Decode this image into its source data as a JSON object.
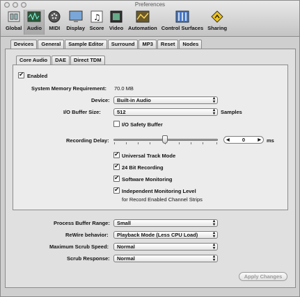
{
  "window": {
    "title": "Preferences"
  },
  "toolbar": {
    "items": [
      {
        "label": "Global",
        "icon": "global-icon"
      },
      {
        "label": "Audio",
        "icon": "audio-icon"
      },
      {
        "label": "MIDI",
        "icon": "midi-icon"
      },
      {
        "label": "Display",
        "icon": "display-icon"
      },
      {
        "label": "Score",
        "icon": "score-icon"
      },
      {
        "label": "Video",
        "icon": "video-icon"
      },
      {
        "label": "Automation",
        "icon": "automation-icon"
      },
      {
        "label": "Control Surfaces",
        "icon": "control-surfaces-icon"
      },
      {
        "label": "Sharing",
        "icon": "sharing-icon"
      }
    ],
    "active": "Audio"
  },
  "tabs": [
    "Devices",
    "General",
    "Sample Editor",
    "Surround",
    "MP3",
    "Reset",
    "Nodes"
  ],
  "subtabs": [
    "Core Audio",
    "DAE",
    "Direct TDM"
  ],
  "core_audio": {
    "enabled_label": "Enabled",
    "memory_label": "System Memory Requirement:",
    "memory_value": "70.0 MB",
    "device_label": "Device:",
    "device_value": "Built-in Audio",
    "buffer_label": "I/O Buffer Size:",
    "buffer_value": "512",
    "buffer_unit": "Samples",
    "safety_label": "I/O Safety Buffer",
    "delay_label": "Recording Delay:",
    "delay_value": "0",
    "delay_unit": "ms",
    "universal_label": "Universal Track Mode",
    "bit24_label": "24 Bit Recording",
    "software_label": "Software Monitoring",
    "independent_label": "Independent Monitoring Level",
    "independent_sub": "for Record Enabled Channel Strips"
  },
  "general": {
    "process_label": "Process Buffer Range:",
    "process_value": "Small",
    "rewire_label": "ReWire behavior:",
    "rewire_value": "Playback Mode (Less CPU Load)",
    "scrub_speed_label": "Maximum Scrub Speed:",
    "scrub_speed_value": "Normal",
    "scrub_resp_label": "Scrub Response:",
    "scrub_resp_value": "Normal"
  },
  "apply_label": "Apply Changes",
  "colors": {
    "window_bg": "#cfcfcf",
    "panel_bg": "#e0e0e0"
  }
}
